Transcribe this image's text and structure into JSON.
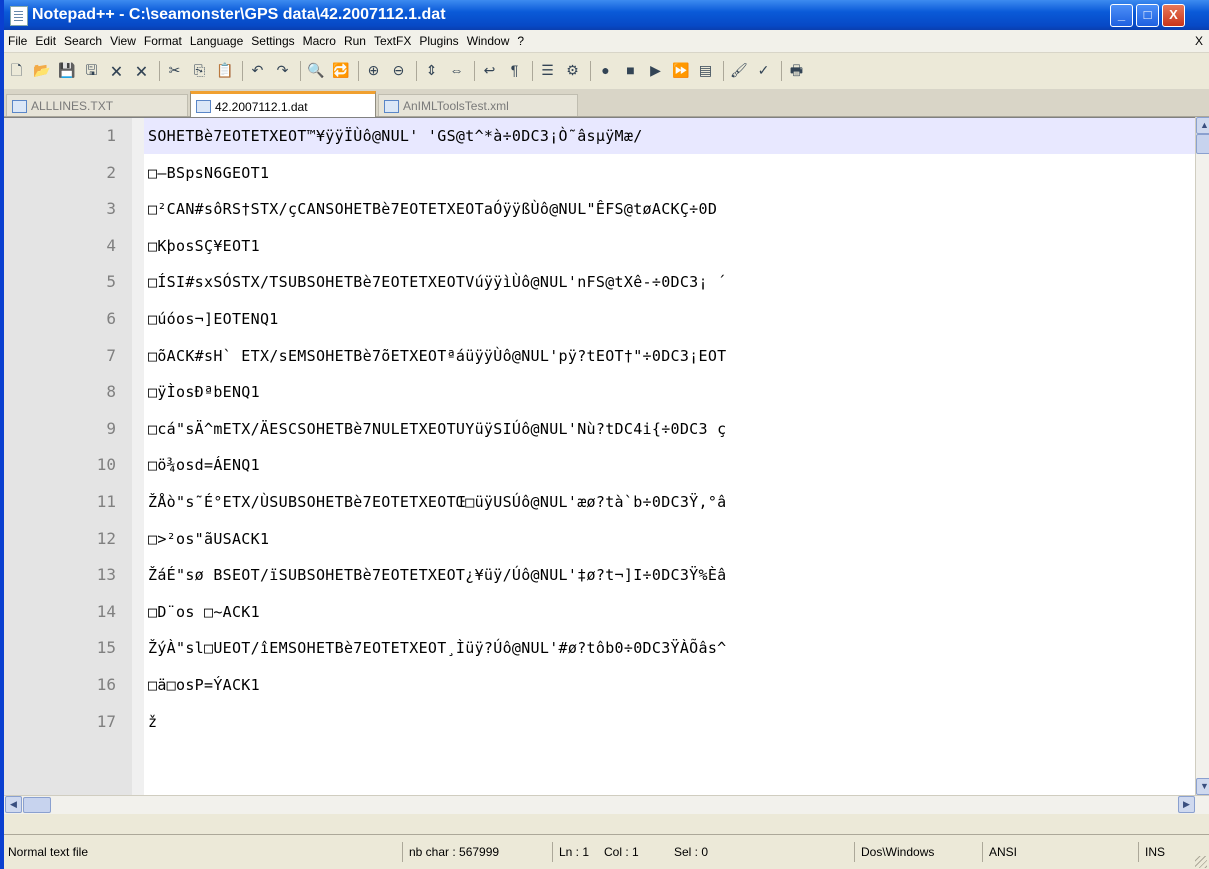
{
  "window": {
    "title": "Notepad++ - C:\\seamonster\\GPS data\\42.2007112.1.dat",
    "minimize": "_",
    "maximize": "□",
    "close": "X"
  },
  "menu": {
    "items": [
      "File",
      "Edit",
      "Search",
      "View",
      "Format",
      "Language",
      "Settings",
      "Macro",
      "Run",
      "TextFX",
      "Plugins",
      "Window",
      "?"
    ],
    "close_doc": "X"
  },
  "toolbar": {
    "icons": [
      "new-file-icon",
      "open-file-icon",
      "save-icon",
      "save-all-icon",
      "close-file-icon",
      "close-all-icon",
      "cut-icon",
      "copy-icon",
      "paste-icon",
      "undo-icon",
      "redo-icon",
      "find-icon",
      "replace-icon",
      "zoom-in-icon",
      "zoom-out-icon",
      "sync-v-icon",
      "sync-h-icon",
      "word-wrap-icon",
      "show-all-chars-icon",
      "indent-guide-icon",
      "user-lang-icon",
      "record-macro-icon",
      "stop-macro-icon",
      "play-macro-icon",
      "play-multiple-icon",
      "save-macro-icon",
      "tidy-icon",
      "spellcheck-icon",
      "print-icon"
    ],
    "glyphs": [
      "🗋",
      "📂",
      "💾",
      "🖫",
      "🗙",
      "🗙",
      "✂",
      "⎘",
      "📋",
      "↶",
      "↷",
      "🔍",
      "🔁",
      "⊕",
      "⊖",
      "⇕",
      "⇔",
      "↩",
      "¶",
      "☰",
      "⚙",
      "●",
      "■",
      "▶",
      "⏩",
      "▤",
      "🖌",
      "✓",
      "🖶"
    ]
  },
  "tabs": [
    {
      "label": "ALLLINES.TXT",
      "active": false
    },
    {
      "label": "42.2007112.1.dat",
      "active": true
    },
    {
      "label": "AnIMLToolsTest.xml",
      "active": false
    }
  ],
  "editor": {
    "lines": [
      {
        "num": "1",
        "text": "SOHETBè7EOTETXEOT™¥ÿÿÏÙô@NUL' 'GS@t^*à÷0DC3¡Ò˜âsµÿMæ/"
      },
      {
        "num": "2",
        "text": "□—BSpsN6GEOT1"
      },
      {
        "num": "3",
        "text": "□²CAN#sôRS†STX/çCANSOHETBè7EOTETXEOTaÓÿÿßÙô@NUL\"ÊFS@tøACKÇ÷0D"
      },
      {
        "num": "4",
        "text": "□KþosSÇ¥EOT1"
      },
      {
        "num": "5",
        "text": "□ÍSI#sxSÓSTX/TSUBSOHETBè7EOTETXEOTVúÿÿìÙô@NUL'nFS@tXê-÷0DC3¡ ´"
      },
      {
        "num": "6",
        "text": "□úóos¬]EOTENQ1"
      },
      {
        "num": "7",
        "text": "□õACK#sH` ETX/sEMSOHETBè7õETXEOTªáüÿÿÙô@NUL'pÿ?tEOT†\"÷0DC3¡EOT"
      },
      {
        "num": "8",
        "text": "□ÿÌosÐªbENQ1"
      },
      {
        "num": "9",
        "text": "□cá\"sÄ^mETX/ÄESCSOHETBè7NULETXEOTUYüÿSIÚô@NUL'Nù?tDC4i{÷0DC3 ç"
      },
      {
        "num": "10",
        "text": "□ö¾osd=ÁENQ1"
      },
      {
        "num": "11",
        "text": "ŽÅò\"s˜É°ETX/ÙSUBSOHETBè7EOTETXEOTŒ□üÿUSÚô@NUL'æø?tà`b÷0DC3Ÿ,°â"
      },
      {
        "num": "12",
        "text": "□>²os\"ãUSACK1"
      },
      {
        "num": "13",
        "text": "ŽáÉ\"sø BSEOT/ïSUBSOHETBè7EOTETXEOT¿¥üÿ/Úô@NUL'‡ø?t¬]I÷0DC3Ÿ%Èâ"
      },
      {
        "num": "14",
        "text": "□D¨os □~ACK1"
      },
      {
        "num": "15",
        "text": "ŽýÀ\"sl□UEOT/îEMSOHETBè7EOTETXEOT¸Ìüÿ?Úô@NUL'#ø?tôb0÷0DC3ŸÀÕâs^"
      },
      {
        "num": "16",
        "text": "□ä□osP=ÝACK1"
      },
      {
        "num": "17",
        "text": "ž"
      }
    ]
  },
  "scrollbar": {
    "up": "▲",
    "down": "▼",
    "left": "◀",
    "right": "▶"
  },
  "status": {
    "file_type": "Normal text file",
    "nb_char": "nb char : 567999",
    "ln": "Ln : 1",
    "col": "Col : 1",
    "sel": "Sel : 0",
    "eol": "Dos\\Windows",
    "encoding": "ANSI",
    "mode": "INS"
  }
}
